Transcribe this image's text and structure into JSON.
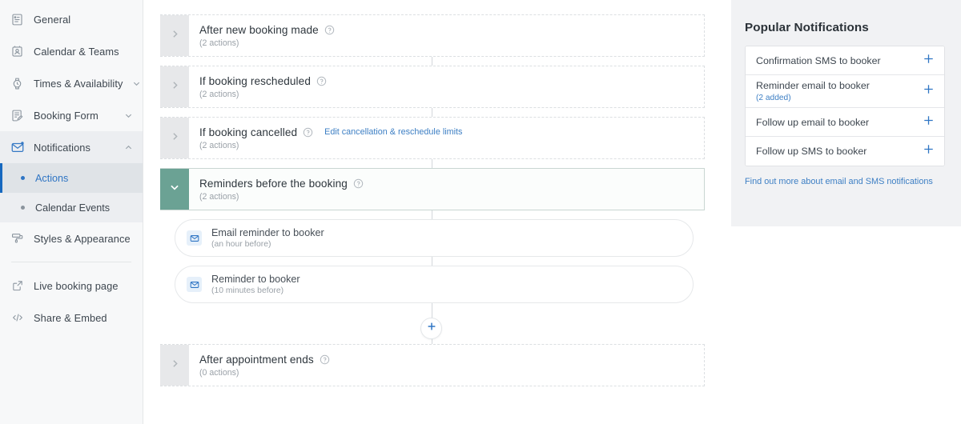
{
  "sidebar": {
    "items": [
      {
        "label": "General",
        "icon": "document-icon",
        "expandable": false
      },
      {
        "label": "Calendar & Teams",
        "icon": "contact-card-icon",
        "expandable": false
      },
      {
        "label": "Times & Availability",
        "icon": "watch-icon",
        "expandable": true,
        "chevron": "chevron-down-icon"
      },
      {
        "label": "Booking Form",
        "icon": "form-edit-icon",
        "expandable": true,
        "chevron": "chevron-down-icon"
      },
      {
        "label": "Notifications",
        "icon": "envelope-notify-icon",
        "expandable": true,
        "chevron": "chevron-up-icon",
        "active_parent": true
      }
    ],
    "sub_items": [
      {
        "label": "Actions",
        "active": true
      },
      {
        "label": "Calendar Events",
        "active": false
      }
    ],
    "after_items": [
      {
        "label": "Styles & Appearance",
        "icon": "paint-roller-icon"
      }
    ],
    "footer_items": [
      {
        "label": "Live booking page",
        "icon": "external-link-icon"
      },
      {
        "label": "Share & Embed",
        "icon": "code-brackets-icon"
      }
    ]
  },
  "flow": {
    "rows": [
      {
        "title": "After new booking made",
        "sub": "(2 actions)",
        "state": "collapsed",
        "chevron": "chevron-right-icon",
        "link": ""
      },
      {
        "title": "If booking rescheduled",
        "sub": "(2 actions)",
        "state": "collapsed",
        "chevron": "chevron-right-icon",
        "link": ""
      },
      {
        "title": "If booking cancelled",
        "sub": "(2 actions)",
        "state": "collapsed",
        "chevron": "chevron-right-icon",
        "link": "Edit cancellation & reschedule limits"
      },
      {
        "title": "Reminders before the booking",
        "sub": "(2 actions)",
        "state": "expanded",
        "chevron": "chevron-down-icon",
        "link": ""
      }
    ],
    "actions": [
      {
        "title": "Email reminder to booker",
        "sub": "(an hour before)",
        "icon": "envelope-icon"
      },
      {
        "title": "Reminder to booker",
        "sub": "(10 minutes before)",
        "icon": "envelope-icon"
      }
    ],
    "add_button": {
      "icon": "plus-icon",
      "label": "+"
    },
    "last_row": {
      "title": "After appointment ends",
      "sub": "(0 actions)",
      "state": "collapsed",
      "chevron": "chevron-right-icon"
    }
  },
  "right_panel": {
    "title": "Popular Notifications",
    "items": [
      {
        "label": "Confirmation SMS to booker",
        "sub": "",
        "action_icon": "plus-icon"
      },
      {
        "label": "Reminder email to booker",
        "sub": "(2 added)",
        "action_icon": "plus-icon"
      },
      {
        "label": "Follow up email to booker",
        "sub": "",
        "action_icon": "plus-icon"
      },
      {
        "label": "Follow up SMS to booker",
        "sub": "",
        "action_icon": "plus-icon"
      }
    ],
    "footer_link": "Find out more about email and SMS notifications"
  },
  "colors": {
    "accent_blue": "#2f75c4",
    "expanded_teal": "#6ba294",
    "sidebar_bg": "#f7f8f9",
    "panel_bg": "#f1f2f4"
  }
}
